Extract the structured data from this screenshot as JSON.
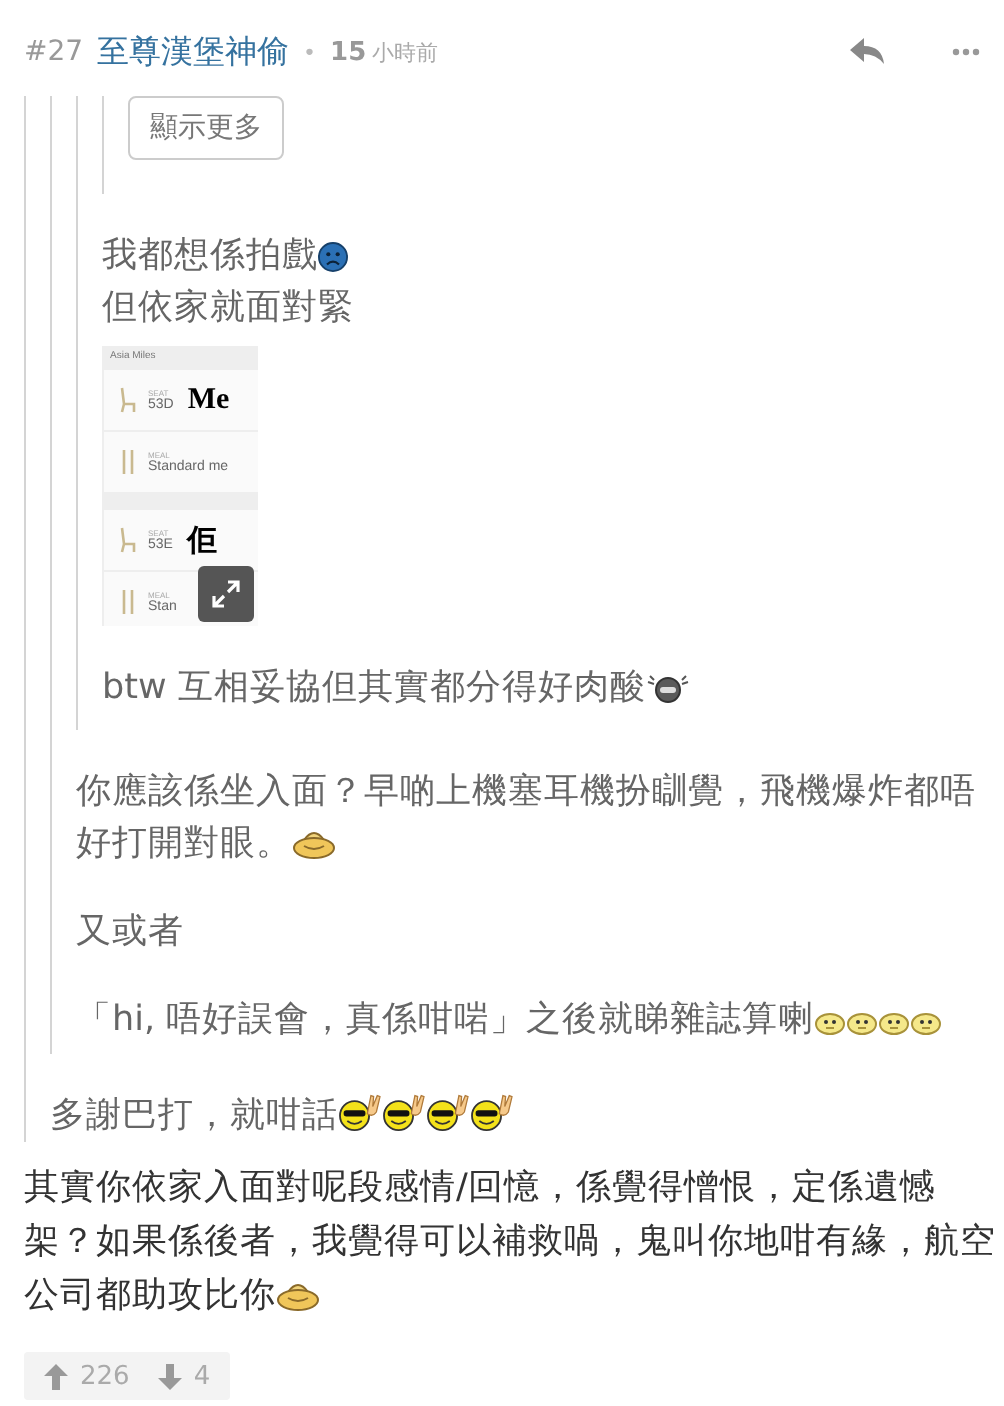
{
  "post": {
    "number": "#27",
    "author": "至尊漢堡神偷",
    "separator": "•",
    "time_value": "15",
    "time_unit": "小時前"
  },
  "quote": {
    "quote": {
      "quote": {
        "quote": {
          "blocks": [
            {
              "kind": "button",
              "label": "顯示更多"
            }
          ]
        },
        "blocks": [
          {
            "kind": "paragraph",
            "lines": [
              [
                {
                  "kind": "text",
                  "text": "我都想係拍戲"
                },
                {
                  "kind": "sad-face"
                }
              ],
              [
                {
                  "kind": "text",
                  "text": "但依家就面對緊"
                }
              ]
            ]
          },
          {
            "kind": "screenshot",
            "header": "Asia Miles",
            "passengers": [
              {
                "seat_label": "SEAT",
                "seat": "53D",
                "note": "Me",
                "meal_label": "MEAL",
                "meal": "Standard me"
              },
              {
                "seat_label": "SEAT",
                "seat": "53E",
                "note": "佢",
                "meal_label": "MEAL",
                "meal": "Stan"
              }
            ]
          },
          {
            "kind": "paragraph",
            "lines": [
              [
                {
                  "kind": "text",
                  "text": "btw 互相妥協但其實都分得好肉酸"
                },
                {
                  "kind": "sweat-face"
                }
              ]
            ]
          }
        ]
      },
      "blocks": [
        {
          "kind": "paragraph",
          "lines": [
            [
              {
                "kind": "text",
                "text": "你應該係坐入面？早啲上機塞耳機扮瞓覺，飛機爆炸都唔"
              }
            ],
            [
              {
                "kind": "text",
                "text": "好打開對眼。"
              },
              {
                "kind": "shy-face"
              }
            ]
          ]
        },
        {
          "kind": "paragraph",
          "lines": [
            [
              {
                "kind": "text",
                "text": "又或者"
              }
            ]
          ]
        },
        {
          "kind": "paragraph",
          "lines": [
            [
              {
                "kind": "text",
                "text": "「hi, 唔好誤會，真係咁啱」之後就睇雜誌算喇"
              },
              {
                "kind": "chick-face"
              },
              {
                "kind": "chick-face"
              },
              {
                "kind": "chick-face"
              },
              {
                "kind": "chick-face"
              }
            ]
          ]
        }
      ]
    },
    "blocks": [
      {
        "kind": "paragraph",
        "lines": [
          [
            {
              "kind": "text",
              "text": "多謝巴打，就咁話"
            },
            {
              "kind": "cool-face"
            },
            {
              "kind": "cool-face"
            },
            {
              "kind": "cool-face"
            },
            {
              "kind": "cool-face"
            }
          ]
        ]
      }
    ]
  },
  "body": [
    {
      "kind": "paragraph",
      "lines": [
        [
          {
            "kind": "text",
            "text": "其實你依家入面對呢段感情/回憶，係覺得憎恨，定係遺憾"
          }
        ],
        [
          {
            "kind": "text",
            "text": "架？如果係後者，我覺得可以補救喎，鬼叫你地咁有緣，航空"
          }
        ],
        [
          {
            "kind": "text",
            "text": "公司都助攻比你"
          },
          {
            "kind": "shy-face"
          }
        ]
      ]
    }
  ],
  "votes": {
    "up": "226",
    "down": "4"
  }
}
